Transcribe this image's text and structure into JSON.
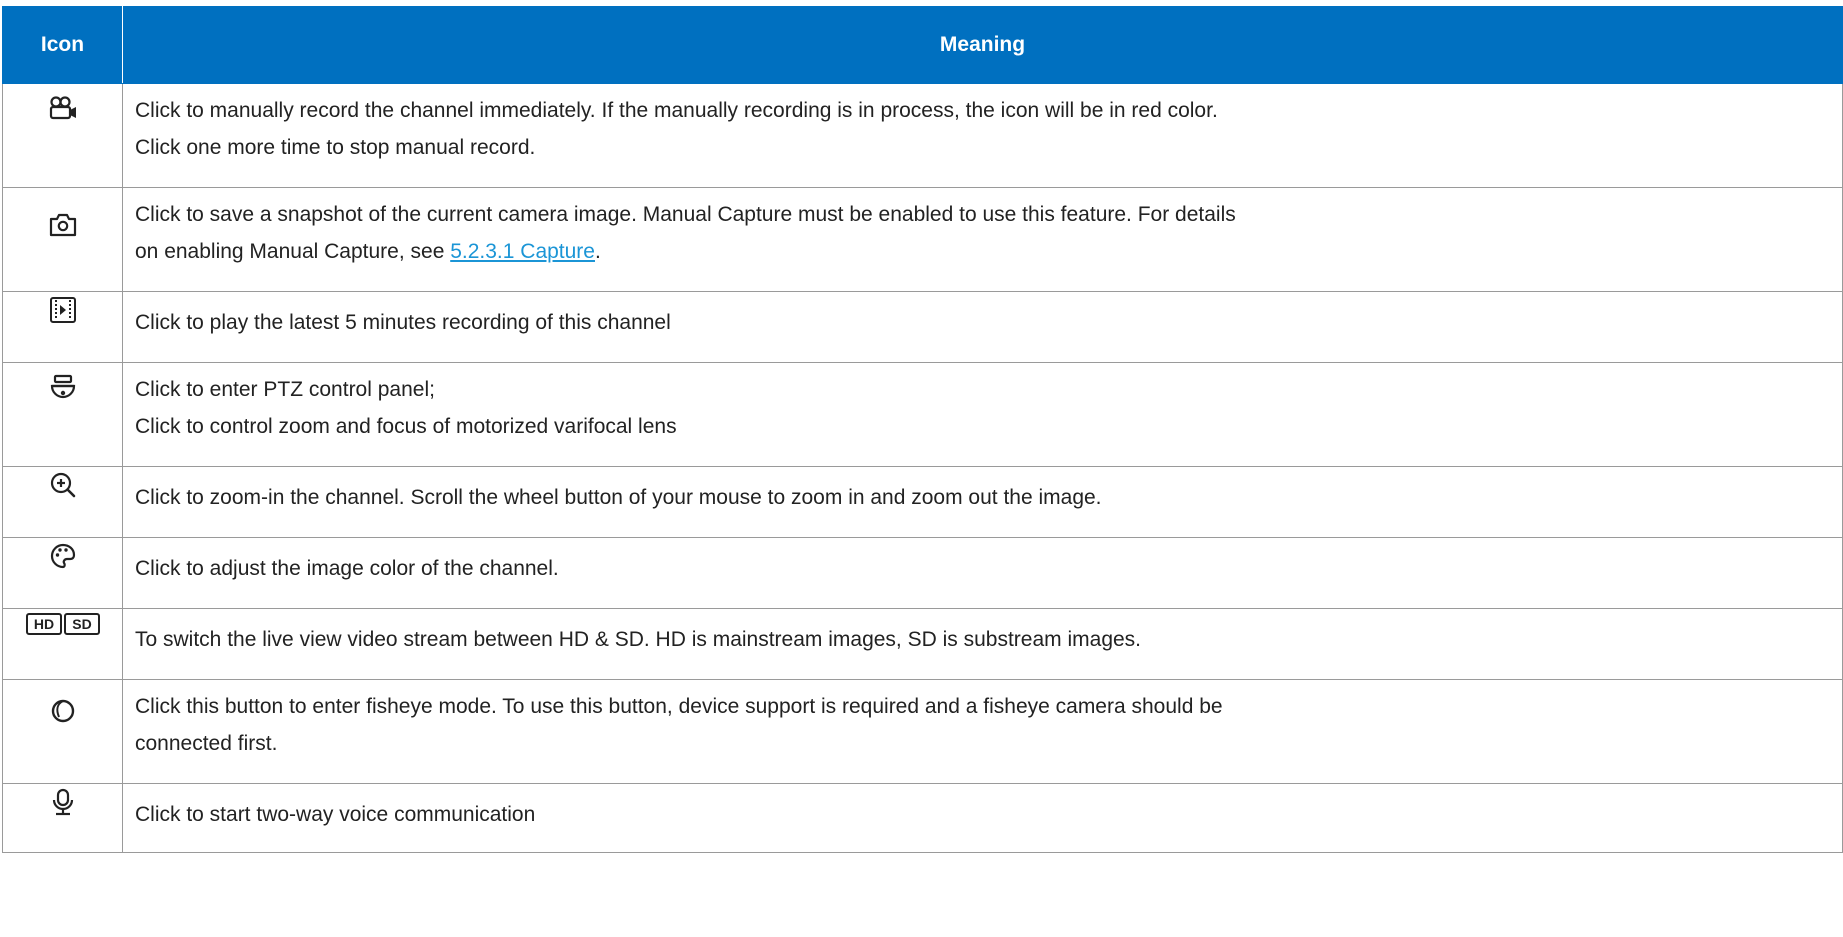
{
  "table": {
    "headers": {
      "icon": "Icon",
      "meaning": "Meaning"
    },
    "header_color": "#0070c0",
    "link_color": "#1b95d6",
    "rows": [
      {
        "icon": "record-camera-icon",
        "lines": [
          "Click to manually record the channel immediately. If the manually recording is in process, the icon will be in red color.",
          "Click one more time to stop manual record."
        ]
      },
      {
        "icon": "camera-snapshot-icon",
        "line1": "Click to save a snapshot of the current camera image. Manual Capture must be enabled to use this feature. For details",
        "line2_prefix": "on enabling Manual Capture, see ",
        "link": "5.2.3.1 Capture",
        "line2_suffix": "."
      },
      {
        "icon": "playback-icon",
        "lines": [
          "Click to play the latest 5 minutes recording of this channel"
        ]
      },
      {
        "icon": "ptz-dome-icon",
        "lines": [
          "Click to enter PTZ control panel;",
          "Click to control zoom and focus of motorized varifocal lens"
        ]
      },
      {
        "icon": "zoom-in-icon",
        "lines": [
          "Click to zoom-in the channel. Scroll the wheel button of your mouse to zoom in and zoom out the image."
        ]
      },
      {
        "icon": "palette-icon",
        "lines": [
          "Click to adjust the image color of the channel."
        ]
      },
      {
        "icon": "hd-sd-icon",
        "hd": "HD",
        "sd": "SD",
        "lines": [
          "To switch the live view video stream between HD & SD. HD is mainstream images, SD is substream images."
        ]
      },
      {
        "icon": "fisheye-icon",
        "lines": [
          "Click this button to enter fisheye mode. To use this button, device support is required and a fisheye camera should be",
          "connected first."
        ]
      },
      {
        "icon": "microphone-icon",
        "lines": [
          "Click to start two-way voice communication"
        ]
      }
    ]
  }
}
